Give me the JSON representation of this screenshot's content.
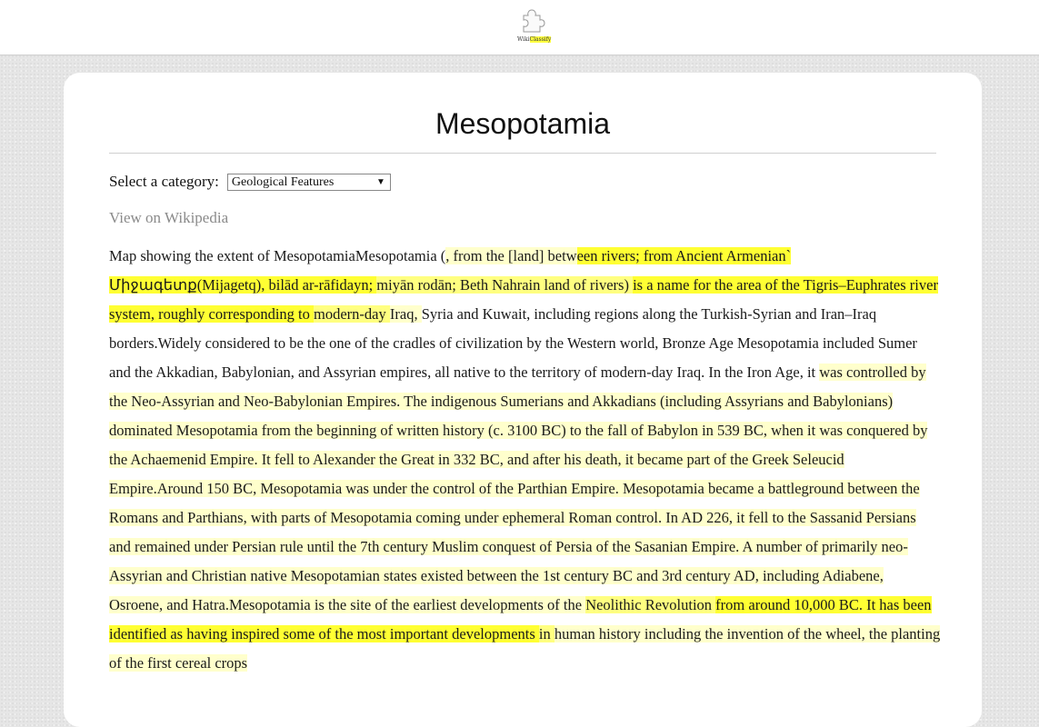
{
  "header": {
    "logo_prefix": "Wiki",
    "logo_suffix": "Classify",
    "logo_icon": "puzzle-piece-icon"
  },
  "page": {
    "title": "Mesopotamia",
    "category_label": "Select a category:",
    "category_selected": "Geological Features",
    "wiki_link": "View on Wikipedia"
  },
  "highlight_colors": {
    "strong": "#ffff33",
    "medium": "#ffff80",
    "light": "#ffffcc"
  },
  "article_segments": [
    {
      "t": "Map showing the extent of MesopotamiaMesopotamia (",
      "h": 0
    },
    {
      "t": ", from the [land] betw",
      "h": 1
    },
    {
      "t": "een rivers; from Ancient Armenian` Միջագետք(Mijagetq), bilād ar-rāfidayn; ",
      "h": 3
    },
    {
      "t": "miyān rodān; Beth Nahrain land of rivers) ",
      "h": 2
    },
    {
      "t": "is a name for the area of the Tigris–Euphrates river system, roughly corresponding to ",
      "h": 3
    },
    {
      "t": "modern-day ",
      "h": 2
    },
    {
      "t": "Iraq, ",
      "h": 1
    },
    {
      "t": "Syria and Kuwait, including regions along the Turkish-Syrian and Iran–Iraq borders.Widely considered to be the one of the cradles of civilization by the Western world, Bronze Age Mesopotamia included Sumer and the Akkadian, Babylonian, and Assyrian empires, all native to the territory of modern-day Iraq. In the Iron Age, it ",
      "h": 0
    },
    {
      "t": "was",
      "h": 1
    },
    {
      "t": " controlled by the Neo-Assyrian and Neo-Babylonian Empires. The indigenous Sumerians and Akkadians (including Assyrians and Babylonians) dominated Mesopotamia from the beginning of written history (c. 3100 BC) to the fall of Babylon in 539 BC, when it was conquered by the Achaemenid Empire. It fell to Alexander the Great in 332 BC, and after his death, it became part of the Greek Seleucid Empire.Around 150 BC, Mesopotamia was under the control of the Parthian Empire.",
      "h": 1
    },
    {
      "t": " Mesopotamia became a battleground between the Romans and Parthians, with parts of Mesopotamia coming under ephemeral Roman control. In AD 226, it fell to the Sassanid Persians and remained under Persian rule until the 7th century Muslim conquest of Persia of the Sasanian Empire. A number of primarily neo-Assyrian and Christian native Mesopotamian states existed between the 1st century BC and 3rd century AD, including Adiabene, Osroene, and Hatra.Mesopotamia is the site of the earliest developments of the ",
      "h": 1
    },
    {
      "t": "Neolithic Revolution ",
      "h": 2
    },
    {
      "t": "from around 10,000 BC. ",
      "h": 3
    },
    {
      "t": "It has been identified as having inspired some of the most important developments ",
      "h": 3
    },
    {
      "t": "in ",
      "h": 2
    },
    {
      "t": "human history including the invention of the wheel, the planting of the first cereal crops",
      "h": 1
    }
  ]
}
